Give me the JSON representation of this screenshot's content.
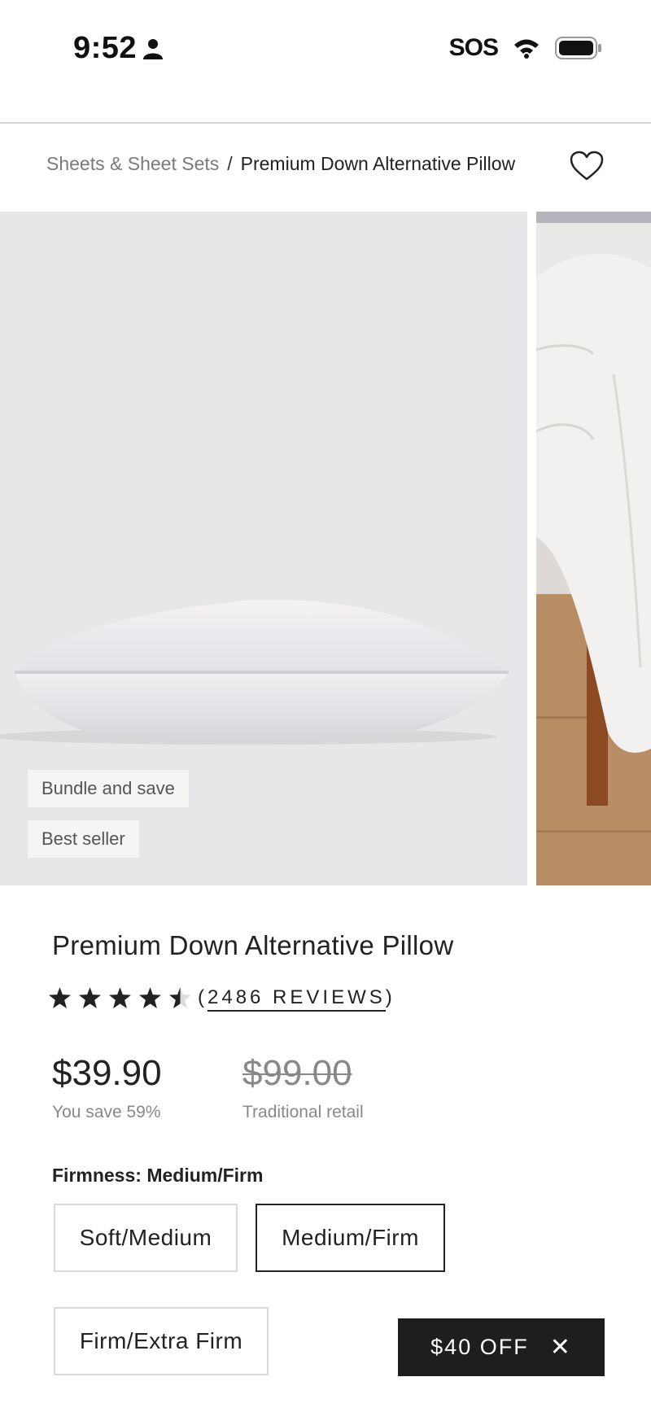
{
  "status_bar": {
    "time": "9:52",
    "carrier": "SOS",
    "icons": [
      "person-icon",
      "wifi-icon",
      "battery-icon"
    ]
  },
  "breadcrumb": {
    "parent": "Sheets & Sheet Sets",
    "separator": "/",
    "current": "Premium Down Alternative Pillow"
  },
  "gallery": {
    "badges": [
      "Bundle and save",
      "Best seller"
    ]
  },
  "product": {
    "title": "Premium Down Alternative Pillow",
    "rating": 4.5,
    "reviews_open": "(",
    "reviews_text": "2486 REVIEWS",
    "reviews_close": ")",
    "price": "$39.90",
    "savings": "You save 59%",
    "retail_price": "$99.00",
    "retail_label": "Traditional retail"
  },
  "firmness": {
    "label": "Firmness: Medium/Firm",
    "options": [
      "Soft/Medium",
      "Medium/Firm",
      "Firm/Extra Firm"
    ],
    "selected": "Medium/Firm"
  },
  "promo": {
    "label": "$40 OFF",
    "close": "✕"
  },
  "colors": {
    "image_bg": "#e7e6e8",
    "promo_bg": "#1e1e1e",
    "muted_text": "#888888"
  }
}
